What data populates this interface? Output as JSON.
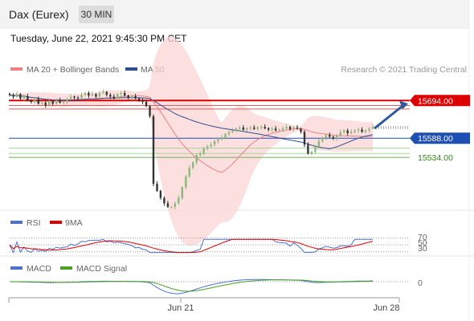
{
  "header": {
    "title": "Dax (Eurex)",
    "interval": "30 MIN"
  },
  "datetime": "Tuesday, June 22, 2021 9:45:30 PM CET",
  "copyright": "Research © 2021 Trading Central",
  "colors": {
    "ma20": "#f08080",
    "bollinger": "#fbd4d4",
    "ma50": "#2e4f8f",
    "resistance": "#dd0000",
    "support_blue": "#1e4fb5",
    "support_green": "#8fc47a",
    "arrow": "#2e5a9c",
    "candle_up": "#8ab87a",
    "candle_down": "#333333",
    "rsi": "#4a72d0",
    "rsi_ma": "#dd0000",
    "macd": "#4a72d0",
    "macd_signal": "#4aa020"
  },
  "chart_data": [
    {
      "type": "candlestick",
      "name": "price",
      "legend": [
        "MA 20 + Bollinger Bands",
        "MA 50"
      ],
      "y_range": [
        15390,
        15760
      ],
      "levels": [
        {
          "label": "15694.00",
          "value": 15694.0,
          "kind": "resistance"
        },
        {
          "label": "15588.00",
          "value": 15588.0,
          "kind": "support_blue"
        },
        {
          "label": "15534.00",
          "value": 15534.0,
          "kind": "support_green"
        }
      ],
      "extra_levels": [
        15680,
        15670,
        15560,
        15545
      ],
      "close": [
        15710,
        15705,
        15712,
        15700,
        15706,
        15695,
        15690,
        15698,
        15685,
        15688,
        15680,
        15692,
        15685,
        15695,
        15688,
        15690,
        15698,
        15705,
        15702,
        15700,
        15710,
        15715,
        15708,
        15712,
        15705,
        15715,
        15718,
        15710,
        15705,
        15700,
        15712,
        15715,
        15708,
        15702,
        15706,
        15700,
        15695,
        15690,
        15678,
        15650,
        15460,
        15440,
        15420,
        15405,
        15395,
        15395,
        15405,
        15420,
        15450,
        15480,
        15505,
        15520,
        15540,
        15545,
        15560,
        15565,
        15570,
        15580,
        15585,
        15590,
        15600,
        15605,
        15610,
        15615,
        15618,
        15612,
        15616,
        15618,
        15614,
        15619,
        15620,
        15616,
        15612,
        15615,
        15610,
        15612,
        15616,
        15620,
        15614,
        15618,
        15615,
        15606,
        15570,
        15545,
        15550,
        15565,
        15580,
        15590,
        15597,
        15592,
        15588,
        15595,
        15605,
        15610,
        15602,
        15606,
        15610,
        15612,
        15606,
        15610,
        15615,
        15620
      ]
    },
    {
      "type": "line",
      "name": "RSI",
      "legend": [
        "RSI",
        "9MA"
      ],
      "levels": [
        70,
        50,
        30
      ],
      "level_labels": [
        "70",
        "50",
        "30"
      ]
    },
    {
      "type": "line",
      "name": "MACD",
      "legend": [
        "MACD",
        "MACD Signal"
      ],
      "levels": [
        0
      ],
      "level_labels": [
        "0"
      ]
    }
  ],
  "x_axis": {
    "labels": [
      "Jun 21",
      "Jun 28"
    ]
  }
}
